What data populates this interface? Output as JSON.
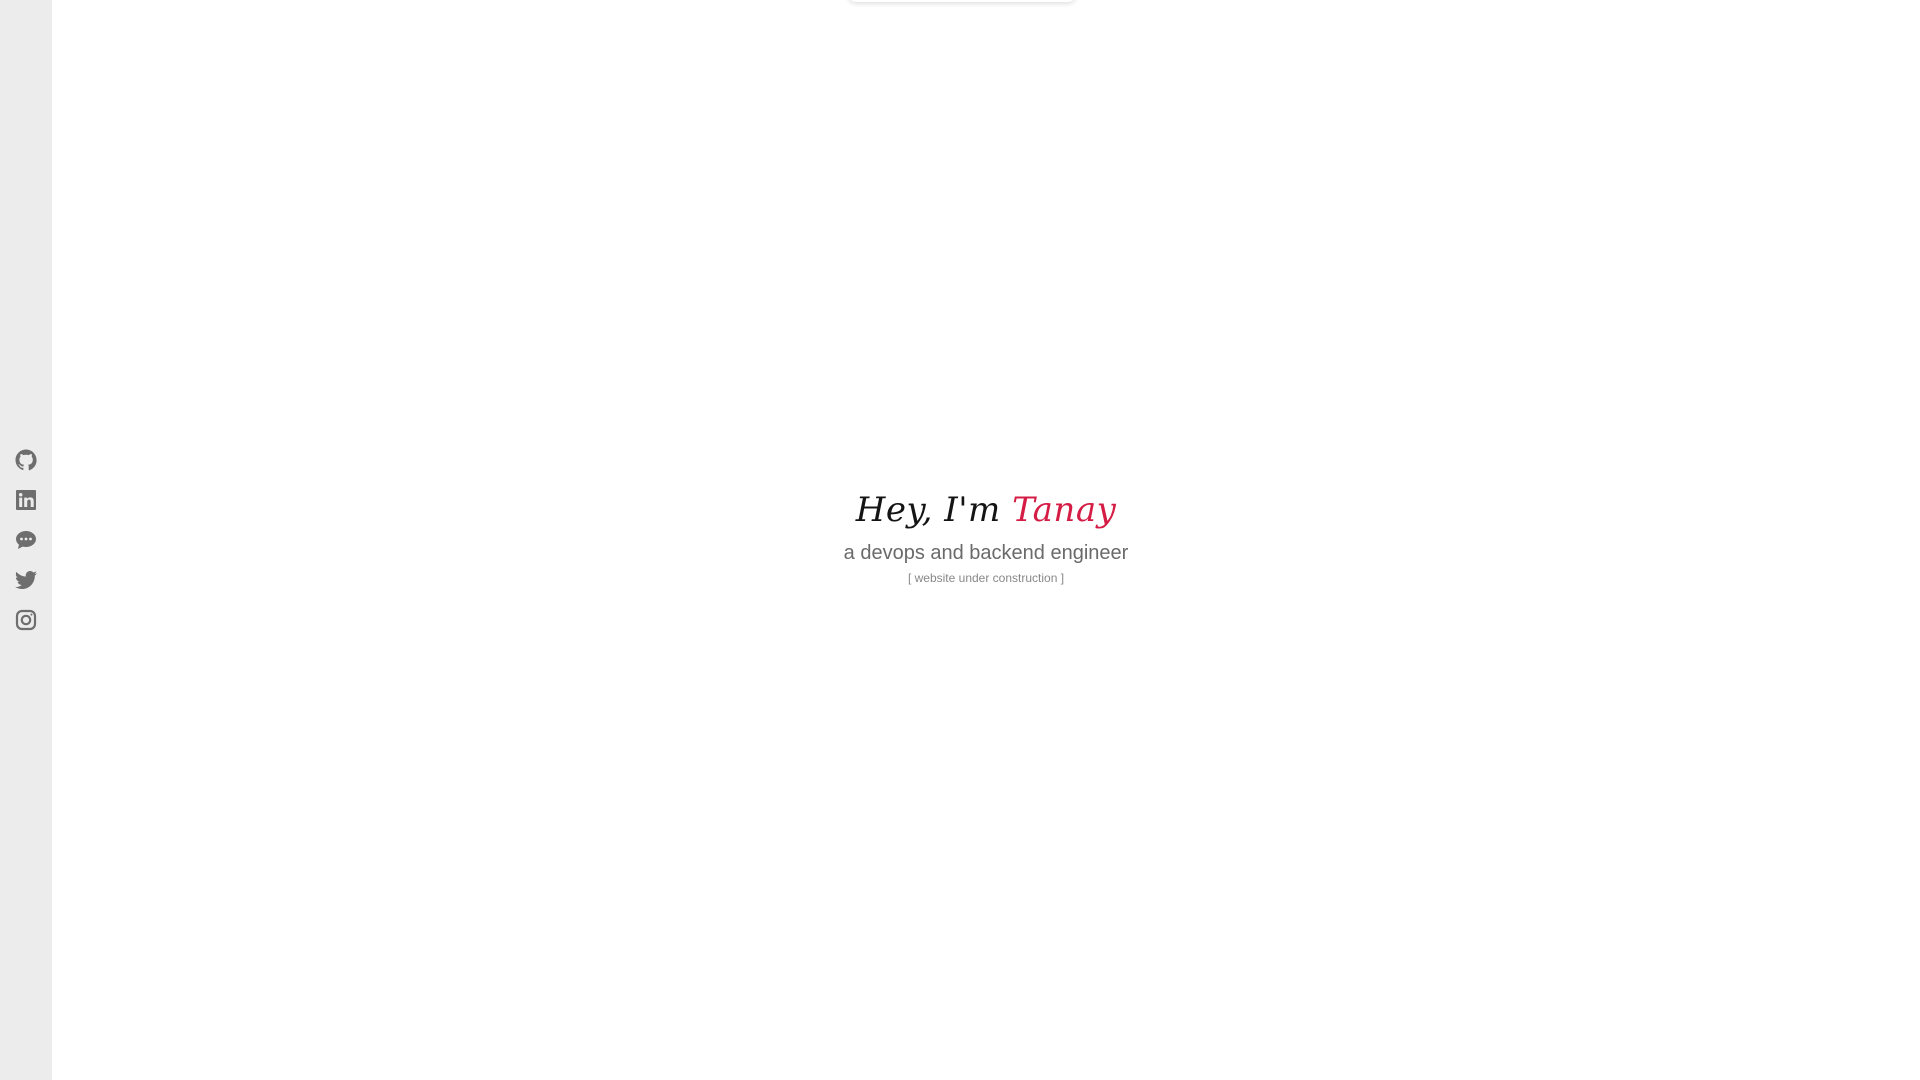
{
  "hero": {
    "greeting_prefix": "Hey, I'm ",
    "name": "Tanay",
    "tagline": "a devops and backend engineer",
    "note": "[ website under construction ]"
  },
  "sidebar": {
    "links": [
      {
        "icon": "github-icon"
      },
      {
        "icon": "linkedin-icon"
      },
      {
        "icon": "chat-icon"
      },
      {
        "icon": "twitter-icon"
      },
      {
        "icon": "instagram-icon"
      }
    ]
  },
  "colors": {
    "accent": "#d41c45",
    "sidebar_bg": "#ececec",
    "icon": "#6e6e6e",
    "heading": "#141414",
    "tagline": "#6a6a6a"
  }
}
